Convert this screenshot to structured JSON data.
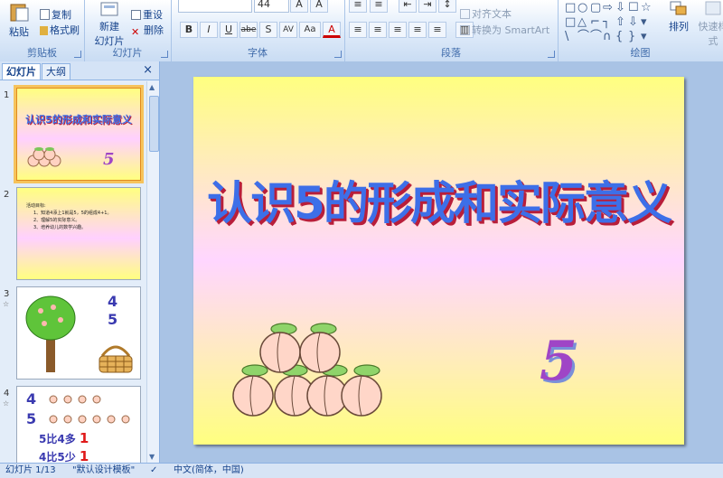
{
  "ribbon": {
    "clipboard": {
      "paste": "粘贴",
      "copy": "复制",
      "format_painter": "格式刷",
      "label": "剪贴板"
    },
    "slides": {
      "new_slide": "新建",
      "new_slide2": "幻灯片",
      "reset": "重设",
      "delete": "删除",
      "label": "幻灯片"
    },
    "font": {
      "size": "44",
      "label": "字体",
      "bold": "B",
      "italic": "I",
      "underline": "U",
      "strike": "abe",
      "shadow": "S",
      "char_spacing": "AV",
      "change_case": "Aa",
      "font_color": "A"
    },
    "paragraph": {
      "align_text": "对齐文本",
      "convert_smartart": "转换为 SmartArt",
      "label": "段落"
    },
    "drawing": {
      "arrange": "排列",
      "quick_styles": "快速样式",
      "label": "绘图"
    }
  },
  "left_pane": {
    "tab_slides": "幻灯片",
    "tab_outline": "大纲",
    "close": "×",
    "thumbs": [
      {
        "num": "1",
        "title": "认识5的形成和实际意义",
        "five": "5"
      },
      {
        "num": "2",
        "lines": [
          "活动目标:",
          "1、知道4添上1就是5，5的组成4+1。",
          "2、理解5的实际意义。",
          "3、培养幼儿的数学兴趣。"
        ]
      },
      {
        "num": "3",
        "n1": "4",
        "n2": "5"
      },
      {
        "num": "4",
        "n1": "4",
        "n2": "5",
        "t1": "5比4多",
        "v1": "1",
        "t2": "4比5少",
        "v2": "1"
      }
    ]
  },
  "slide": {
    "title": "认识5的形成和实际意义",
    "five": "5"
  },
  "status": {
    "slide_count": "幻灯片 1/13",
    "theme": "\"默认设计模板\"",
    "language": "中文(简体，中国)"
  }
}
